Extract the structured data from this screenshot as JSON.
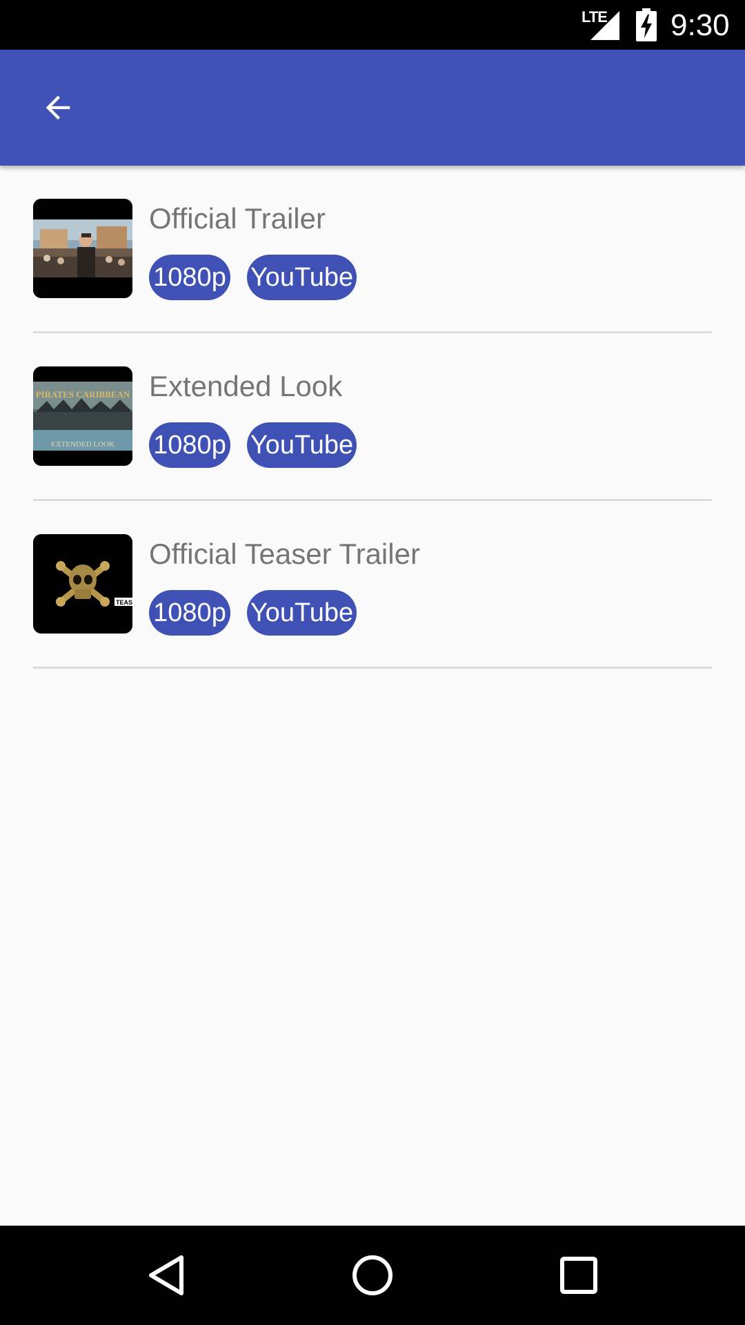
{
  "status_bar": {
    "network": "LTE",
    "time": "9:30",
    "icons": [
      "lte-signal-icon",
      "battery-charging-icon"
    ]
  },
  "app_bar": {
    "back_icon": "arrow-back-icon"
  },
  "videos": [
    {
      "title": "Official Trailer",
      "quality": "1080p",
      "site": "YouTube",
      "thumbnail": "official-trailer-thumbnail"
    },
    {
      "title": "Extended Look",
      "quality": "1080p",
      "site": "YouTube",
      "thumbnail": "extended-look-thumbnail",
      "thumbnail_text": [
        "PIRATES CARIBBEAN",
        "EXTENDED LOOK"
      ]
    },
    {
      "title": "Official Teaser Trailer",
      "quality": "1080p",
      "site": "YouTube",
      "thumbnail": "teaser-trailer-thumbnail",
      "thumbnail_text": [
        "TEAS"
      ]
    }
  ],
  "nav_bar": {
    "back": "nav-back-icon",
    "home": "nav-home-icon",
    "recents": "nav-recents-icon"
  },
  "colors": {
    "primary": "#3f51b5",
    "background": "#fafafa",
    "title_text": "#757575",
    "divider": "#dcdcdc"
  }
}
